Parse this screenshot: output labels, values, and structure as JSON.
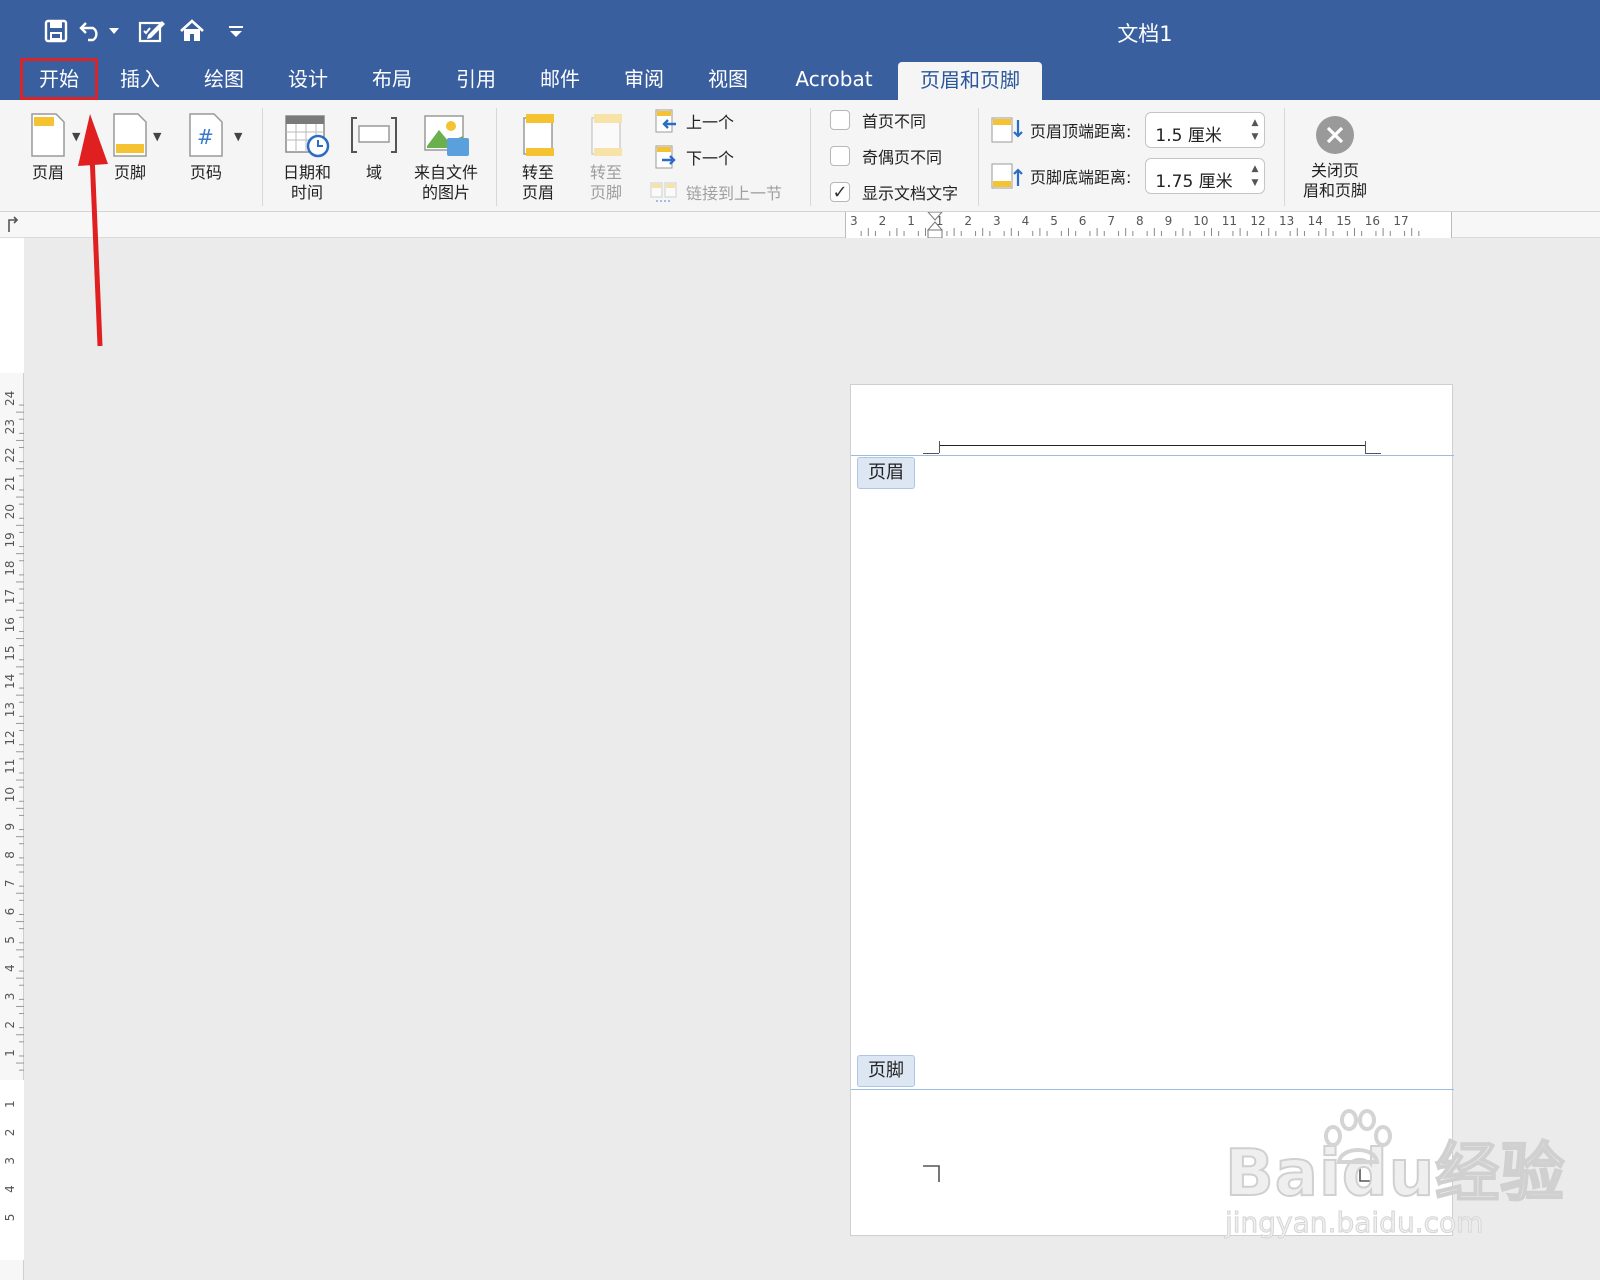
{
  "window": {
    "title": "文档1"
  },
  "qat": {
    "icons": [
      "save-icon",
      "undo-icon",
      "undo-dropdown-icon",
      "edit-icon",
      "home-icon",
      "customize-dropdown-icon"
    ]
  },
  "tabs": [
    {
      "label": "开始",
      "highlighted": true
    },
    {
      "label": "插入"
    },
    {
      "label": "绘图"
    },
    {
      "label": "设计"
    },
    {
      "label": "布局"
    },
    {
      "label": "引用"
    },
    {
      "label": "邮件"
    },
    {
      "label": "审阅"
    },
    {
      "label": "视图"
    },
    {
      "label": "Acrobat"
    },
    {
      "label": "页眉和页脚",
      "active": true
    }
  ],
  "ribbon": {
    "header_label": "页眉",
    "footer_label": "页脚",
    "page_number_label": "页码",
    "datetime_label_1": "日期和",
    "datetime_label_2": "时间",
    "field_label": "域",
    "picture_label_1": "来自文件",
    "picture_label_2": "的图片",
    "goto_header_1": "转至",
    "goto_header_2": "页眉",
    "goto_footer_1": "转至",
    "goto_footer_2": "页脚",
    "previous_label": "上一个",
    "next_label": "下一个",
    "link_previous_label": "链接到上一节",
    "different_first_page": "首页不同",
    "different_odd_even": "奇偶页不同",
    "show_document_text": "显示文档文字",
    "different_first_page_checked": false,
    "different_odd_even_checked": false,
    "show_document_text_checked": true,
    "header_top_label": "页眉顶端距离:",
    "header_top_value": "1.5 厘米",
    "footer_bottom_label": "页脚底端距离:",
    "footer_bottom_value": "1.75 厘米",
    "close_label_1": "关闭页",
    "close_label_2": "眉和页脚"
  },
  "ruler": {
    "hlabels": [
      "3",
      "2",
      "1",
      "1",
      "2",
      "3",
      "4",
      "5",
      "6",
      "7",
      "8",
      "9",
      "10",
      "11",
      "12",
      "13",
      "14",
      "15",
      "16",
      "17"
    ],
    "vlabels_top": [
      "24",
      "23",
      "22",
      "21",
      "20",
      "19",
      "18",
      "17",
      "16",
      "15",
      "14",
      "13",
      "12",
      "11",
      "10",
      "9",
      "8",
      "7",
      "6",
      "5",
      "4",
      "3",
      "2",
      "1"
    ],
    "vlabels_bottom": [
      "1",
      "2",
      "3",
      "4",
      "5"
    ]
  },
  "page": {
    "header_tag": "页眉",
    "footer_tag": "页脚"
  },
  "watermark": {
    "line1": "Baidu经验",
    "line2": "jingyan.baidu.com"
  },
  "annotation": {
    "color": "#e02020"
  }
}
